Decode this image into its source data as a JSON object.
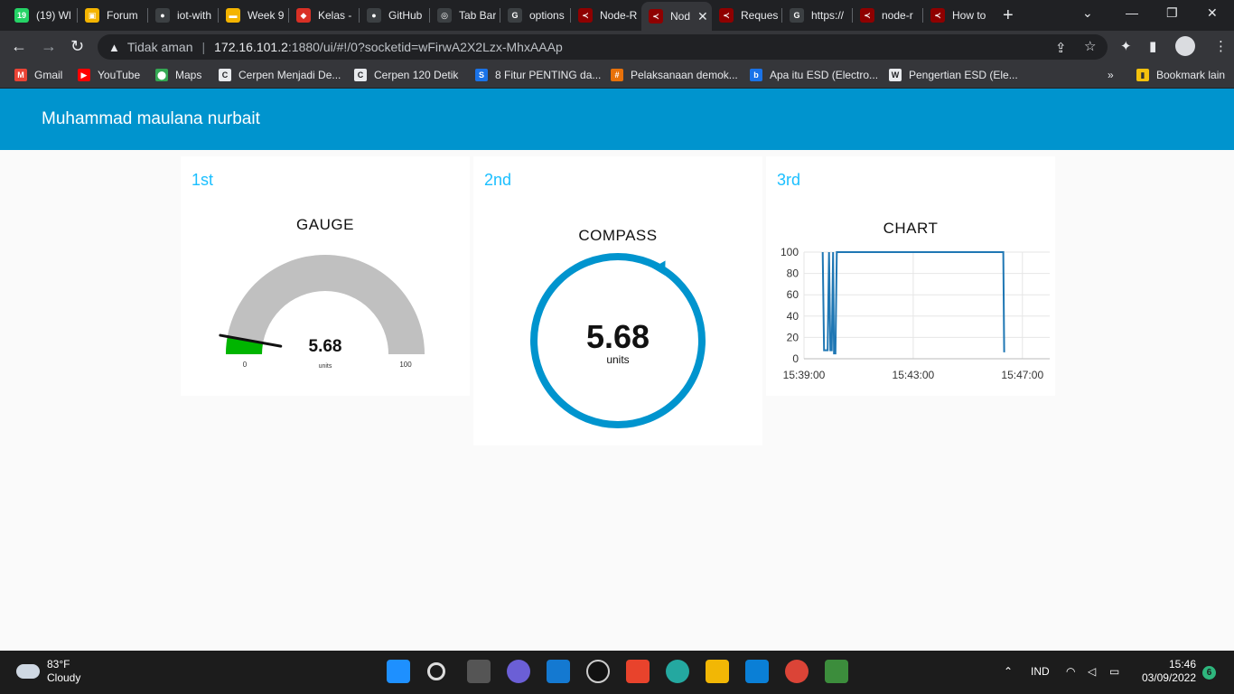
{
  "browser": {
    "tabs": [
      {
        "label": "(19) Wl",
        "color": "#25d366",
        "glyph": "19"
      },
      {
        "label": "Forum",
        "color": "#f4b400",
        "glyph": "▣"
      },
      {
        "label": "iot-with",
        "color": "#ffffff",
        "glyph": "●"
      },
      {
        "label": "Week 9",
        "color": "#f4b400",
        "glyph": "▬"
      },
      {
        "label": "Kelas -",
        "color": "#d93025",
        "glyph": "◆"
      },
      {
        "label": "GitHub",
        "color": "#ffffff",
        "glyph": "●"
      },
      {
        "label": "Tab Bar",
        "color": "#ffffff",
        "glyph": "◎"
      },
      {
        "label": "options",
        "color": "#ffffff",
        "glyph": "G"
      },
      {
        "label": "Node-R",
        "color": "#8f0000",
        "glyph": "≺"
      },
      {
        "label": "Nod",
        "color": "#8f0000",
        "glyph": "≺"
      },
      {
        "label": "Reques",
        "color": "#8f0000",
        "glyph": "≺"
      },
      {
        "label": "https://",
        "color": "#ffffff",
        "glyph": "G"
      },
      {
        "label": "node-r",
        "color": "#8f0000",
        "glyph": "≺"
      },
      {
        "label": "How to",
        "color": "#8f0000",
        "glyph": "≺"
      }
    ],
    "active_tab_index": 9,
    "security_label": "Tidak aman",
    "url_host": "172.16.101.2",
    "url_rest": ":1880/ui/#!/0?socketid=wFirwA2X2Lzx-MhxAAAp",
    "bookmarks": [
      {
        "label": "Gmail",
        "color": "#ea4335",
        "glyph": "M"
      },
      {
        "label": "YouTube",
        "color": "#ff0000",
        "glyph": "▶"
      },
      {
        "label": "Maps",
        "color": "#34a853",
        "glyph": "⬤"
      },
      {
        "label": "Cerpen Menjadi De...",
        "color": "#ffffff",
        "glyph": "C"
      },
      {
        "label": "Cerpen 120 Detik",
        "color": "#ffffff",
        "glyph": "C"
      },
      {
        "label": "8 Fitur PENTING da...",
        "color": "#1a73e8",
        "glyph": "S"
      },
      {
        "label": "Pelaksanaan demok...",
        "color": "#e8710a",
        "glyph": "#"
      },
      {
        "label": "Apa itu ESD (Electro...",
        "color": "#1a73e8",
        "glyph": "b"
      },
      {
        "label": "Pengertian ESD (Ele...",
        "color": "#ffffff",
        "glyph": "W"
      }
    ],
    "more_bookmarks": "»",
    "other_bookmarks": "Bookmark lain"
  },
  "dashboard": {
    "title": "Muhammad maulana nurbait",
    "cards": [
      {
        "title": "1st",
        "widget": "GAUGE"
      },
      {
        "title": "2nd",
        "widget": "COMPASS"
      },
      {
        "title": "3rd",
        "widget": "CHART"
      }
    ],
    "gauge": {
      "value": "5.68",
      "value_num": 5.68,
      "units": "units",
      "min": "0",
      "max": "100",
      "fill_color": "#00b500",
      "track_color": "#c0c0c0"
    },
    "compass": {
      "value": "5.68",
      "heading_deg": 5.68,
      "units": "units",
      "ring_color": "#0094ce"
    }
  },
  "chart_data": {
    "type": "line",
    "title": "CHART",
    "xlabel": "",
    "ylabel": "",
    "ylim": [
      0,
      100
    ],
    "yticks": [
      "100",
      "80",
      "60",
      "40",
      "20",
      "0"
    ],
    "xticks": [
      "15:39:00",
      "15:43:00",
      "15:47:00"
    ],
    "xlim": [
      "15:39:00",
      "15:48:00"
    ],
    "series": [
      {
        "color": "#1f77b4",
        "x": [
          "15:39:41",
          "15:39:44",
          "15:39:47",
          "15:39:52",
          "15:39:55",
          "15:39:58",
          "15:40:01",
          "15:40:04",
          "15:40:06",
          "15:40:09",
          "15:40:12",
          "15:40:14",
          "15:46:18",
          "15:46:20"
        ],
        "y": [
          100,
          8,
          8,
          8,
          100,
          8,
          8,
          100,
          5,
          5,
          100,
          100,
          100,
          6
        ]
      }
    ]
  },
  "taskbar": {
    "temperature": "83°F",
    "condition": "Cloudy",
    "language": "IND",
    "time": "15:46",
    "date": "03/09/2022",
    "notifications": "6"
  }
}
